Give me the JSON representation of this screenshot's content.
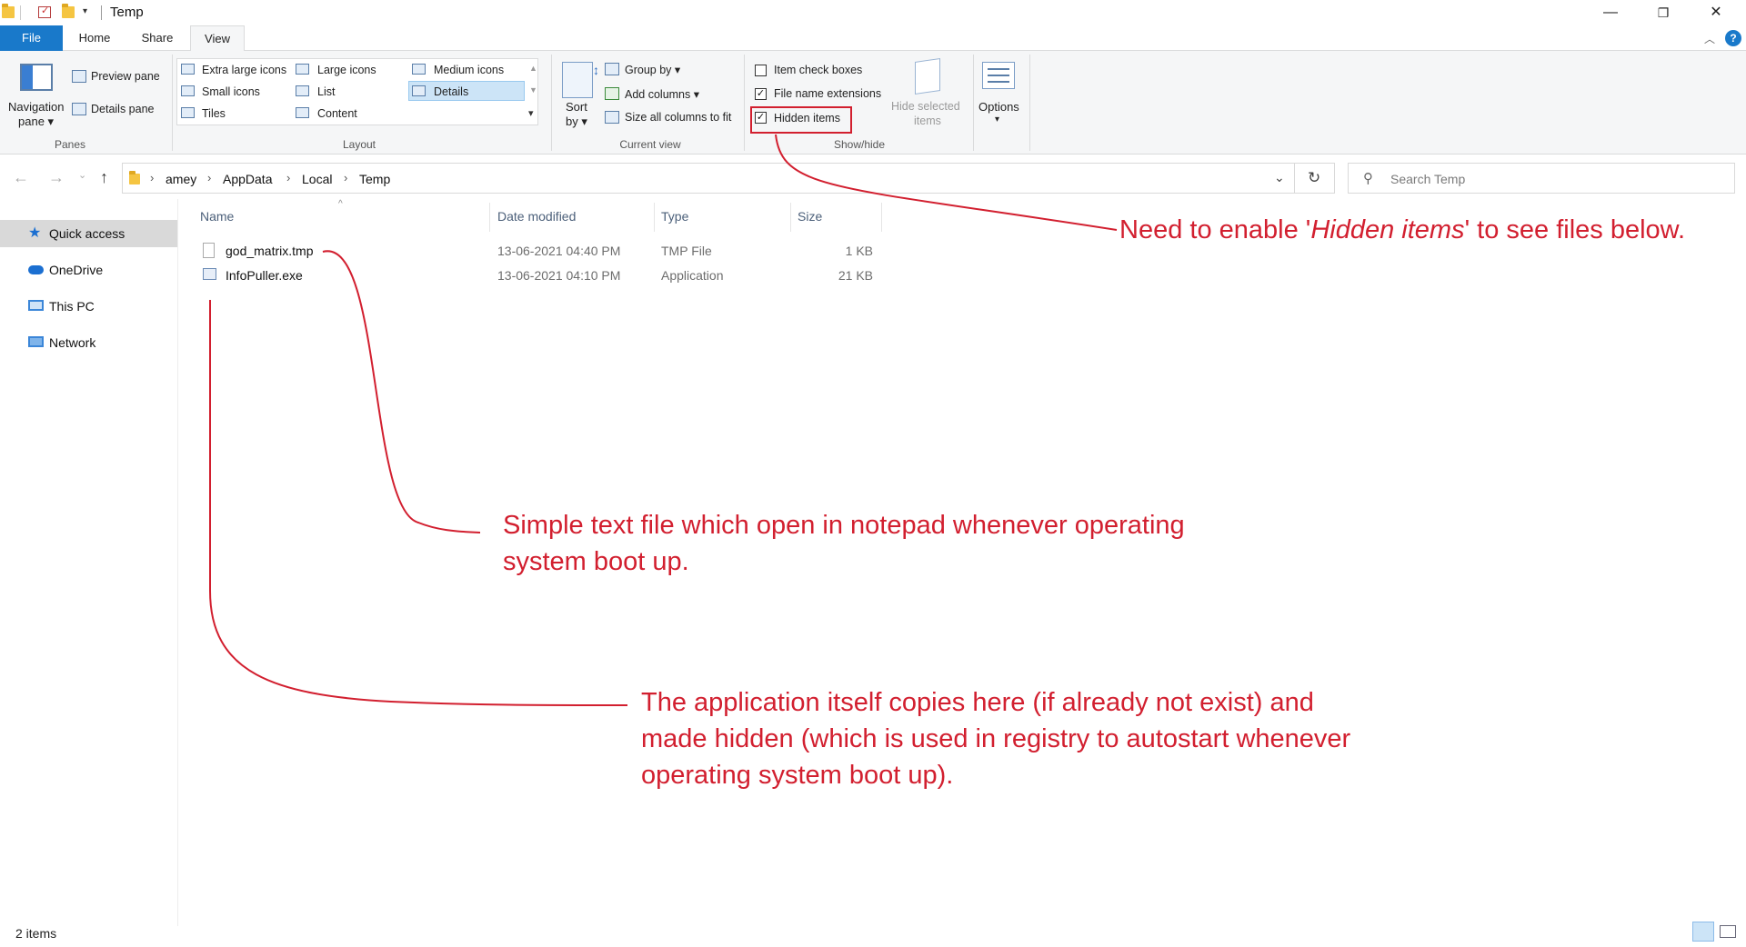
{
  "window": {
    "title": "Temp",
    "minimize_glyph": "—",
    "restore_glyph": "❐",
    "close_glyph": "✕"
  },
  "tabs": [
    {
      "label": "File"
    },
    {
      "label": "Home"
    },
    {
      "label": "Share"
    },
    {
      "label": "View"
    }
  ],
  "ribbon": {
    "panes": {
      "navigation_pane": "Navigation",
      "navigation_pane_2": "pane ▾",
      "preview_pane": "Preview pane",
      "details_pane": "Details pane",
      "group_label": "Panes"
    },
    "layout": {
      "items": [
        "Extra large icons",
        "Large icons",
        "Medium icons",
        "Small icons",
        "List",
        "Details",
        "Tiles",
        "Content"
      ],
      "selected": "Details",
      "group_label": "Layout"
    },
    "current_view": {
      "sort_by": "Sort",
      "sort_by_2": "by ▾",
      "group_by": "Group by ▾",
      "add_columns": "Add columns ▾",
      "size_all_columns": "Size all columns to fit",
      "group_label": "Current view"
    },
    "show_hide": {
      "item_check_boxes": {
        "label": "Item check boxes",
        "checked": false
      },
      "file_name_extensions": {
        "label": "File name extensions",
        "checked": true
      },
      "hidden_items": {
        "label": "Hidden items",
        "checked": true
      },
      "hide_selected_1": "Hide selected",
      "hide_selected_2": "items",
      "group_label": "Show/hide"
    },
    "options": {
      "label": "Options",
      "arrow": "▾"
    }
  },
  "address": {
    "breadcrumbs": [
      "amey",
      "AppData",
      "Local",
      "Temp"
    ],
    "search_placeholder": "Search Temp"
  },
  "sidebar": {
    "items": [
      {
        "label": "Quick access",
        "selected": true
      },
      {
        "label": "OneDrive"
      },
      {
        "label": "This PC"
      },
      {
        "label": "Network"
      }
    ]
  },
  "filelist": {
    "columns": [
      "Name",
      "Date modified",
      "Type",
      "Size"
    ],
    "rows": [
      {
        "name": "god_matrix.tmp",
        "date": "13-06-2021 04:40 PM",
        "type": "TMP File",
        "size": "1 KB"
      },
      {
        "name": "InfoPuller.exe",
        "date": "13-06-2021 04:10 PM",
        "type": "Application",
        "size": "21 KB"
      }
    ]
  },
  "status": {
    "item_count": "2 items"
  },
  "annotations": {
    "note1_prefix": "Need to enable '",
    "note1_em": "Hidden items",
    "note1_suffix": "' to see files below.",
    "note2_line1": "Simple text file which open in notepad whenever operating",
    "note2_line2": "system boot up.",
    "note3_line1": "The application itself copies here (if already not exist) and",
    "note3_line2": "made hidden (which is used in registry to autostart whenever",
    "note3_line3": "operating system boot up).",
    "color": "#d21f2f"
  }
}
